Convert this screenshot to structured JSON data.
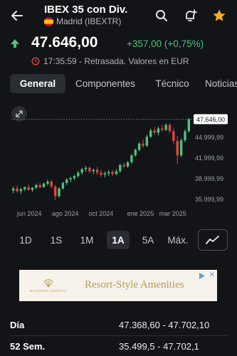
{
  "header": {
    "title": "IBEX 35 con Div.",
    "subtitle": "Madrid (IBEXTR)",
    "icons": [
      "back-arrow-icon",
      "spain-flag-icon",
      "search-icon",
      "add-alert-bell-icon",
      "star-icon"
    ]
  },
  "quote": {
    "price": "47.646,00",
    "change": "+357,00 (+0,75%)",
    "status": "17:35:59 - Retrasada. Valores en EUR",
    "colors": {
      "up": "#4cc47d",
      "down": "#e0463f",
      "star": "#f2b01e"
    }
  },
  "tabs": [
    {
      "label": "General",
      "active": true
    },
    {
      "label": "Componentes",
      "active": false
    },
    {
      "label": "Técnico",
      "active": false
    },
    {
      "label": "Noticias",
      "active": false
    }
  ],
  "chart_data": {
    "type": "candlestick",
    "x_tick_labels": [
      "jun 2024",
      "ago 2024",
      "oct 2024",
      "ene 2025",
      "mar 2025"
    ],
    "y_tick_labels": [
      "35.999,99",
      "38.999,99",
      "41.999,99",
      "44.999,99"
    ],
    "ylim": [
      35200,
      48200
    ],
    "last_price_label": "47.646,00",
    "grid": false,
    "candles": [
      {
        "o": 37300,
        "h": 37900,
        "l": 36900,
        "c": 37600
      },
      {
        "o": 37600,
        "h": 38000,
        "l": 37000,
        "c": 37200
      },
      {
        "o": 37200,
        "h": 37700,
        "l": 36800,
        "c": 37500
      },
      {
        "o": 37500,
        "h": 37900,
        "l": 37200,
        "c": 37800
      },
      {
        "o": 37800,
        "h": 38200,
        "l": 37300,
        "c": 37400
      },
      {
        "o": 37400,
        "h": 37800,
        "l": 37100,
        "c": 37700
      },
      {
        "o": 37700,
        "h": 38300,
        "l": 37500,
        "c": 38100
      },
      {
        "o": 38100,
        "h": 38400,
        "l": 37600,
        "c": 37800
      },
      {
        "o": 37800,
        "h": 38500,
        "l": 37700,
        "c": 38300
      },
      {
        "o": 38300,
        "h": 38900,
        "l": 38000,
        "c": 38600
      },
      {
        "o": 38600,
        "h": 38800,
        "l": 37600,
        "c": 37900
      },
      {
        "o": 37900,
        "h": 38100,
        "l": 35900,
        "c": 36500
      },
      {
        "o": 36500,
        "h": 37800,
        "l": 36300,
        "c": 37600
      },
      {
        "o": 37600,
        "h": 38600,
        "l": 37400,
        "c": 38400
      },
      {
        "o": 38400,
        "h": 39100,
        "l": 38100,
        "c": 38900
      },
      {
        "o": 38900,
        "h": 39300,
        "l": 38500,
        "c": 39100
      },
      {
        "o": 39100,
        "h": 39600,
        "l": 38800,
        "c": 39400
      },
      {
        "o": 39400,
        "h": 40200,
        "l": 39200,
        "c": 39900
      },
      {
        "o": 39900,
        "h": 40600,
        "l": 39600,
        "c": 40400
      },
      {
        "o": 40400,
        "h": 40900,
        "l": 40000,
        "c": 40600
      },
      {
        "o": 40600,
        "h": 40800,
        "l": 39800,
        "c": 40100
      },
      {
        "o": 40100,
        "h": 40500,
        "l": 39700,
        "c": 40300
      },
      {
        "o": 40300,
        "h": 40700,
        "l": 39600,
        "c": 39900
      },
      {
        "o": 39900,
        "h": 40300,
        "l": 39300,
        "c": 39600
      },
      {
        "o": 39600,
        "h": 40100,
        "l": 39200,
        "c": 39800
      },
      {
        "o": 39800,
        "h": 40300,
        "l": 39400,
        "c": 40000
      },
      {
        "o": 40000,
        "h": 40300,
        "l": 39400,
        "c": 39700
      },
      {
        "o": 39700,
        "h": 40400,
        "l": 39500,
        "c": 40100
      },
      {
        "o": 40100,
        "h": 41200,
        "l": 39900,
        "c": 41000
      },
      {
        "o": 41000,
        "h": 41400,
        "l": 40500,
        "c": 40800
      },
      {
        "o": 40800,
        "h": 41600,
        "l": 40600,
        "c": 41400
      },
      {
        "o": 41400,
        "h": 42600,
        "l": 41200,
        "c": 42400
      },
      {
        "o": 42400,
        "h": 43400,
        "l": 42200,
        "c": 43200
      },
      {
        "o": 43200,
        "h": 44300,
        "l": 43000,
        "c": 44100
      },
      {
        "o": 44100,
        "h": 44700,
        "l": 43500,
        "c": 43800
      },
      {
        "o": 43800,
        "h": 45400,
        "l": 43600,
        "c": 45100
      },
      {
        "o": 45100,
        "h": 46300,
        "l": 44900,
        "c": 46000
      },
      {
        "o": 46000,
        "h": 46500,
        "l": 45400,
        "c": 45700
      },
      {
        "o": 45700,
        "h": 46600,
        "l": 45300,
        "c": 46300
      },
      {
        "o": 46300,
        "h": 46800,
        "l": 45800,
        "c": 46100
      },
      {
        "o": 46100,
        "h": 47000,
        "l": 45900,
        "c": 46800
      },
      {
        "o": 46800,
        "h": 47000,
        "l": 45600,
        "c": 45900
      },
      {
        "o": 45900,
        "h": 46400,
        "l": 44000,
        "c": 44500
      },
      {
        "o": 44500,
        "h": 45200,
        "l": 41100,
        "c": 42400
      },
      {
        "o": 42400,
        "h": 44900,
        "l": 42100,
        "c": 44600
      },
      {
        "o": 44600,
        "h": 46200,
        "l": 44300,
        "c": 45900
      },
      {
        "o": 45900,
        "h": 47800,
        "l": 45700,
        "c": 47646
      }
    ]
  },
  "ranges": [
    {
      "label": "1D",
      "active": false
    },
    {
      "label": "1S",
      "active": false
    },
    {
      "label": "1M",
      "active": false
    },
    {
      "label": "1A",
      "active": true
    },
    {
      "label": "5A",
      "active": false
    },
    {
      "label": "Máx.",
      "active": false
    }
  ],
  "ad": {
    "headline": "Resort-Style Amenities",
    "logo_text": "MANDARIN ORIENTAL"
  },
  "stats": [
    {
      "label": "Día",
      "value": "47.368,60 - 47.702,10"
    },
    {
      "label": "52 Sem.",
      "value": "35.499,5 - 47.702,1"
    }
  ]
}
